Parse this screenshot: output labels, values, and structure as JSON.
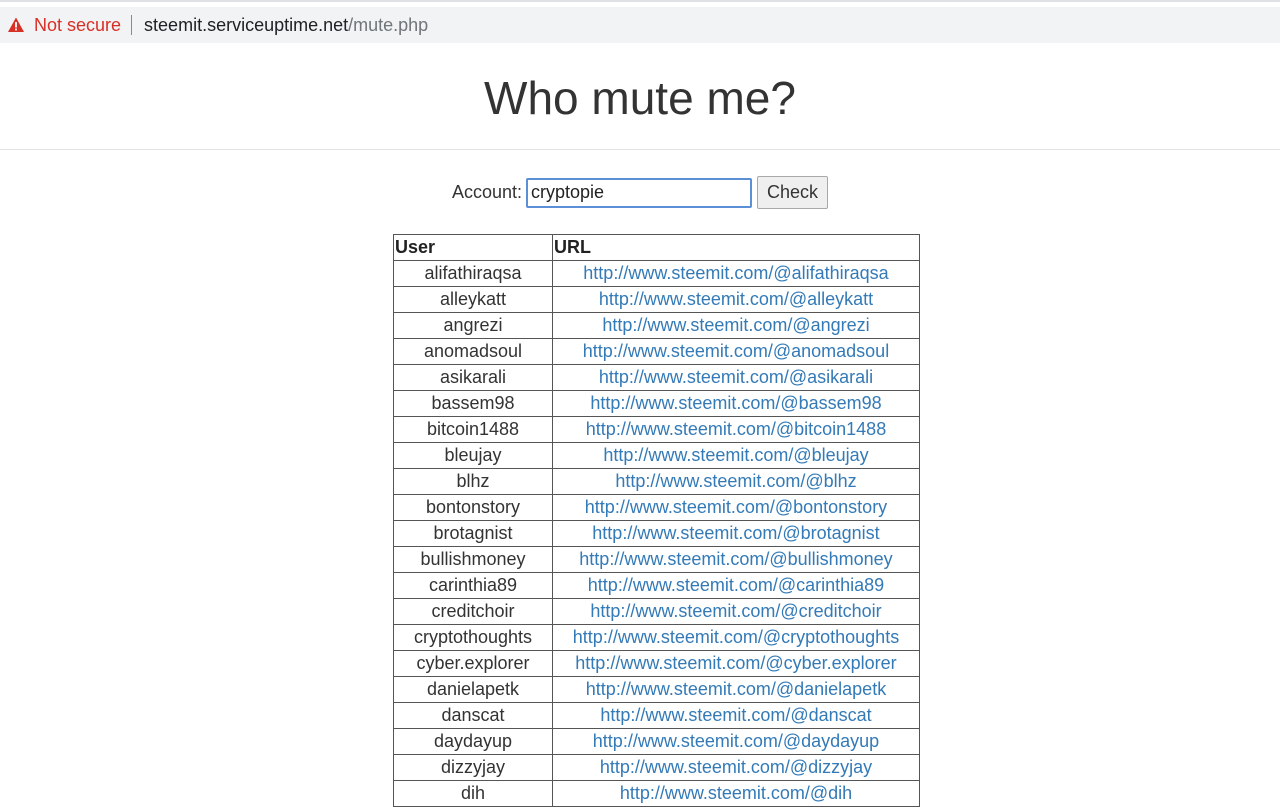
{
  "browser": {
    "security_label": "Not secure",
    "url_host": "steemit.serviceuptime.net",
    "url_path": "/mute.php"
  },
  "page": {
    "title": "Who mute me?",
    "account_label": "Account:",
    "account_value": "cryptopie",
    "check_label": "Check"
  },
  "table": {
    "headers": [
      "User",
      "URL"
    ],
    "rows": [
      {
        "user": "alifathiraqsa",
        "url": "http://www.steemit.com/@alifathiraqsa"
      },
      {
        "user": "alleykatt",
        "url": "http://www.steemit.com/@alleykatt"
      },
      {
        "user": "angrezi",
        "url": "http://www.steemit.com/@angrezi"
      },
      {
        "user": "anomadsoul",
        "url": "http://www.steemit.com/@anomadsoul"
      },
      {
        "user": "asikarali",
        "url": "http://www.steemit.com/@asikarali"
      },
      {
        "user": "bassem98",
        "url": "http://www.steemit.com/@bassem98"
      },
      {
        "user": "bitcoin1488",
        "url": "http://www.steemit.com/@bitcoin1488"
      },
      {
        "user": "bleujay",
        "url": "http://www.steemit.com/@bleujay"
      },
      {
        "user": "blhz",
        "url": "http://www.steemit.com/@blhz"
      },
      {
        "user": "bontonstory",
        "url": "http://www.steemit.com/@bontonstory"
      },
      {
        "user": "brotagnist",
        "url": "http://www.steemit.com/@brotagnist"
      },
      {
        "user": "bullishmoney",
        "url": "http://www.steemit.com/@bullishmoney"
      },
      {
        "user": "carinthia89",
        "url": "http://www.steemit.com/@carinthia89"
      },
      {
        "user": "creditchoir",
        "url": "http://www.steemit.com/@creditchoir"
      },
      {
        "user": "cryptothoughts",
        "url": "http://www.steemit.com/@cryptothoughts"
      },
      {
        "user": "cyber.explorer",
        "url": "http://www.steemit.com/@cyber.explorer"
      },
      {
        "user": "danielapetk",
        "url": "http://www.steemit.com/@danielapetk"
      },
      {
        "user": "danscat",
        "url": "http://www.steemit.com/@danscat"
      },
      {
        "user": "daydayup",
        "url": "http://www.steemit.com/@daydayup"
      },
      {
        "user": "dizzyjay",
        "url": "http://www.steemit.com/@dizzyjay"
      },
      {
        "user": "dih",
        "url": "http://www.steemit.com/@dih"
      }
    ]
  },
  "colors": {
    "warning": "#d93025",
    "link": "#337ab7",
    "input_focus_border": "#5b8fd6"
  },
  "icons": {
    "security": "warning-triangle-icon"
  }
}
